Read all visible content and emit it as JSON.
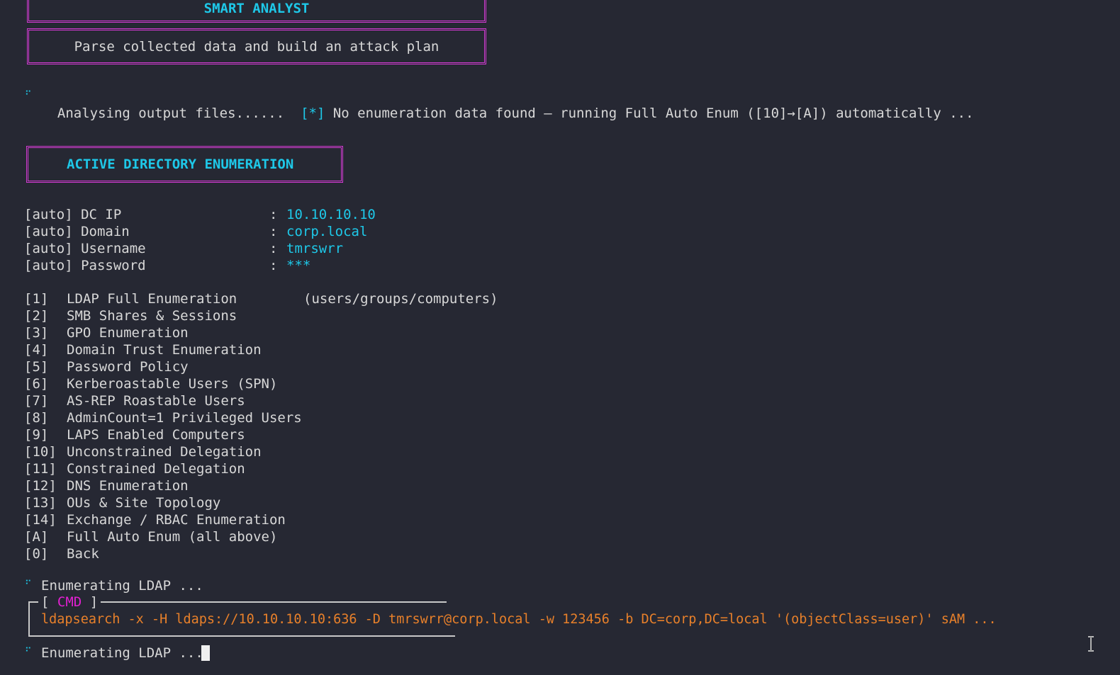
{
  "banners": {
    "smart_analyst_title": "SMART ANALYST",
    "smart_analyst_subtitle": "Parse collected data and build an attack plan",
    "ad_enum_title": "ACTIVE DIRECTORY ENUMERATION"
  },
  "status": {
    "analysing_text": "Analysing output files......",
    "notice_prefix": "[*]",
    "notice_text": "No enumeration data found — running Full Auto Enum ([10]→[A]) automatically ..."
  },
  "auto_config": [
    {
      "label": "[auto] DC IP",
      "value": "10.10.10.10"
    },
    {
      "label": "[auto] Domain",
      "value": "corp.local"
    },
    {
      "label": "[auto] Username",
      "value": "tmrswrr"
    },
    {
      "label": "[auto] Password",
      "value": "***"
    }
  ],
  "auto_separator": ":",
  "menu": [
    {
      "key": "[1]",
      "label": "LDAP Full Enumeration",
      "note": "(users/groups/computers)"
    },
    {
      "key": "[2]",
      "label": "SMB Shares & Sessions"
    },
    {
      "key": "[3]",
      "label": "GPO Enumeration"
    },
    {
      "key": "[4]",
      "label": "Domain Trust Enumeration"
    },
    {
      "key": "[5]",
      "label": "Password Policy"
    },
    {
      "key": "[6]",
      "label": "Kerberoastable Users (SPN)"
    },
    {
      "key": "[7]",
      "label": "AS-REP Roastable Users"
    },
    {
      "key": "[8]",
      "label": "AdminCount=1 Privileged Users"
    },
    {
      "key": "[9]",
      "label": "LAPS Enabled Computers"
    },
    {
      "key": "[10]",
      "label": "Unconstrained Delegation"
    },
    {
      "key": "[11]",
      "label": "Constrained Delegation"
    },
    {
      "key": "[12]",
      "label": "DNS Enumeration"
    },
    {
      "key": "[13]",
      "label": "OUs & Site Topology"
    },
    {
      "key": "[14]",
      "label": "Exchange / RBAC Enumeration"
    },
    {
      "key": "[A]",
      "label": "Full Auto Enum (all above)"
    },
    {
      "key": "[0]",
      "label": "Back"
    }
  ],
  "progress": {
    "enum_ldap_1": "Enumerating LDAP ...",
    "enum_ldap_2": "Enumerating LDAP ..."
  },
  "cmd": {
    "open": "[",
    "label": "CMD",
    "close": "]",
    "command": "ldapsearch -x -H ldaps://10.10.10.10:636 -D tmrswrr@corp.local -w 123456 -b DC=corp,DC=local '(objectClass=user)' sAM ..."
  },
  "icons": {
    "spinner": "spinner-icon",
    "text_cursor": "text-cursor-icon"
  },
  "colors": {
    "background": "#262833",
    "accent_cyan": "#1ec8e8",
    "border_magenta": "#d43bd4",
    "cmd_orange": "#e8802a"
  }
}
